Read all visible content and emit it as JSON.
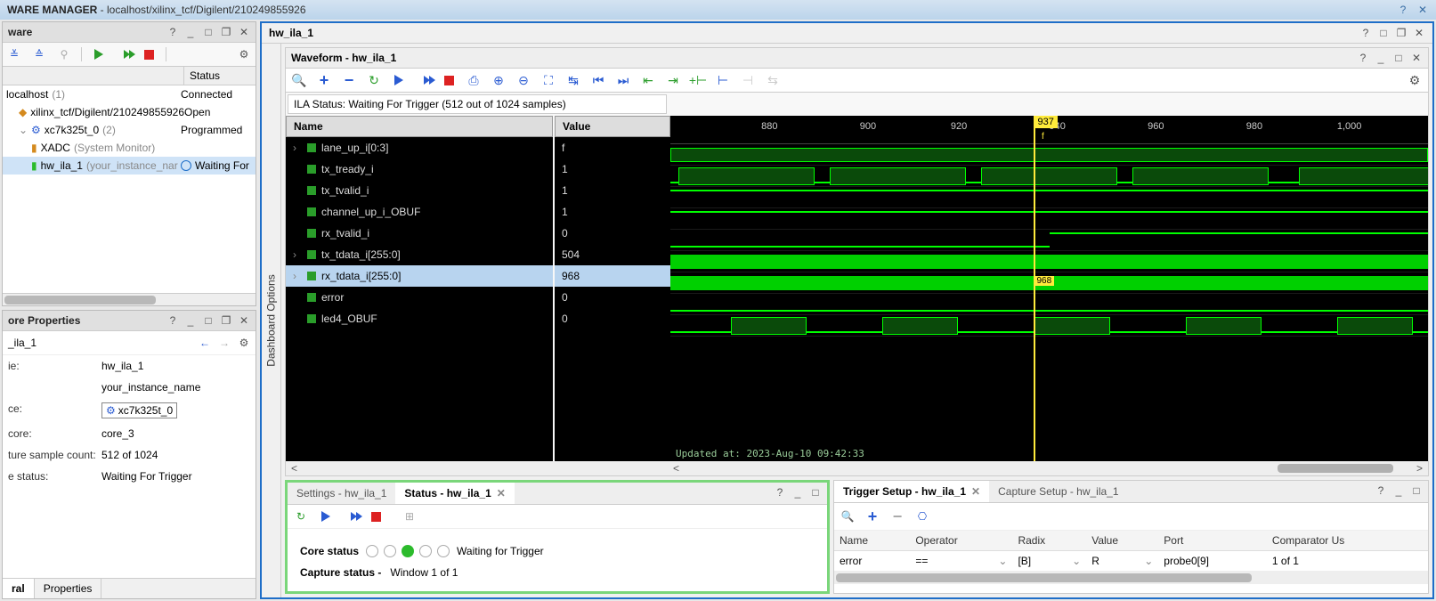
{
  "titlebar": {
    "app": "WARE MANAGER",
    "path": " - localhost/xilinx_tcf/Digilent/210249855926"
  },
  "hw_panel": {
    "title": "ware",
    "columns": {
      "name": "",
      "status": "Status"
    },
    "rows": [
      {
        "name": "localhost",
        "count": "(1)",
        "status": "Connected",
        "indent": 0
      },
      {
        "name": "xilinx_tcf/Digilent/210249855926",
        "status": "Open",
        "indent": 1
      },
      {
        "name": "xc7k325t_0",
        "count": "(2)",
        "status": "Programmed",
        "indent": 1,
        "expand": true
      },
      {
        "name": "XADC",
        "hint": "(System Monitor)",
        "status": "",
        "indent": 2
      },
      {
        "name": "hw_ila_1",
        "hint": "(your_instance_nar",
        "status": "Waiting For",
        "indent": 2,
        "selected": true,
        "radio": true
      }
    ]
  },
  "props_panel": {
    "title": "ore Properties",
    "name": "_ila_1",
    "rows": [
      {
        "label": "ie:",
        "value": "hw_ila_1"
      },
      {
        "label": "",
        "value": "your_instance_name"
      },
      {
        "label": "ce:",
        "value": "xc7k325t_0",
        "chip": true
      },
      {
        "label": "core:",
        "value": "core_3"
      },
      {
        "label": "ture sample count:",
        "value": "512 of 1024"
      },
      {
        "label": "e status:",
        "value": "Waiting For Trigger"
      }
    ],
    "tabs": [
      "ral",
      "Properties"
    ]
  },
  "ila": {
    "title": "hw_ila_1",
    "dashboard": "Dashboard Options",
    "waveform": {
      "title": "Waveform - hw_ila_1",
      "status": "ILA Status: Waiting For Trigger (512 out of 1024 samples)",
      "name_col": "Name",
      "value_col": "Value",
      "cursor": "937",
      "sel_bus_val": "968",
      "ticks": [
        "880",
        "900",
        "920",
        "940",
        "960",
        "980",
        "1,000"
      ],
      "signals": [
        {
          "name": "lane_up_i[0:3]",
          "value": "f",
          "expand": true,
          "type": "bus"
        },
        {
          "name": "tx_tready_i",
          "value": "1",
          "type": "toggle"
        },
        {
          "name": "tx_tvalid_i",
          "value": "1",
          "type": "hi"
        },
        {
          "name": "channel_up_i_OBUF",
          "value": "1",
          "type": "hi"
        },
        {
          "name": "rx_tvalid_i",
          "value": "0",
          "type": "step"
        },
        {
          "name": "tx_tdata_i[255:0]",
          "value": "504",
          "expand": true,
          "type": "wbus"
        },
        {
          "name": "rx_tdata_i[255:0]",
          "value": "968",
          "expand": true,
          "type": "wbus",
          "selected": true
        },
        {
          "name": "error",
          "value": "0",
          "type": "low"
        },
        {
          "name": "led4_OBUF",
          "value": "0",
          "type": "toggle2"
        }
      ],
      "updated": "Updated at: 2023-Aug-10 09:42:33"
    },
    "status_panel": {
      "tabs": [
        {
          "label": "Settings - hw_ila_1"
        },
        {
          "label": "Status - hw_ila_1",
          "active": true,
          "closable": true
        }
      ],
      "core_status_label": "Core status",
      "core_status_text": "Waiting for Trigger",
      "capture_label": "Capture status -",
      "capture_value": "Window 1 of 1"
    },
    "trigger_panel": {
      "tabs": [
        {
          "label": "Trigger Setup - hw_ila_1",
          "active": true,
          "closable": true
        },
        {
          "label": "Capture Setup - hw_ila_1"
        }
      ],
      "headers": [
        "Name",
        "Operator",
        "Radix",
        "Value",
        "Port",
        "Comparator Us"
      ],
      "row": {
        "name": "error",
        "operator": "==",
        "radix": "[B]",
        "value": "R",
        "port": "probe0[9]",
        "comp": "1 of 1"
      }
    }
  }
}
